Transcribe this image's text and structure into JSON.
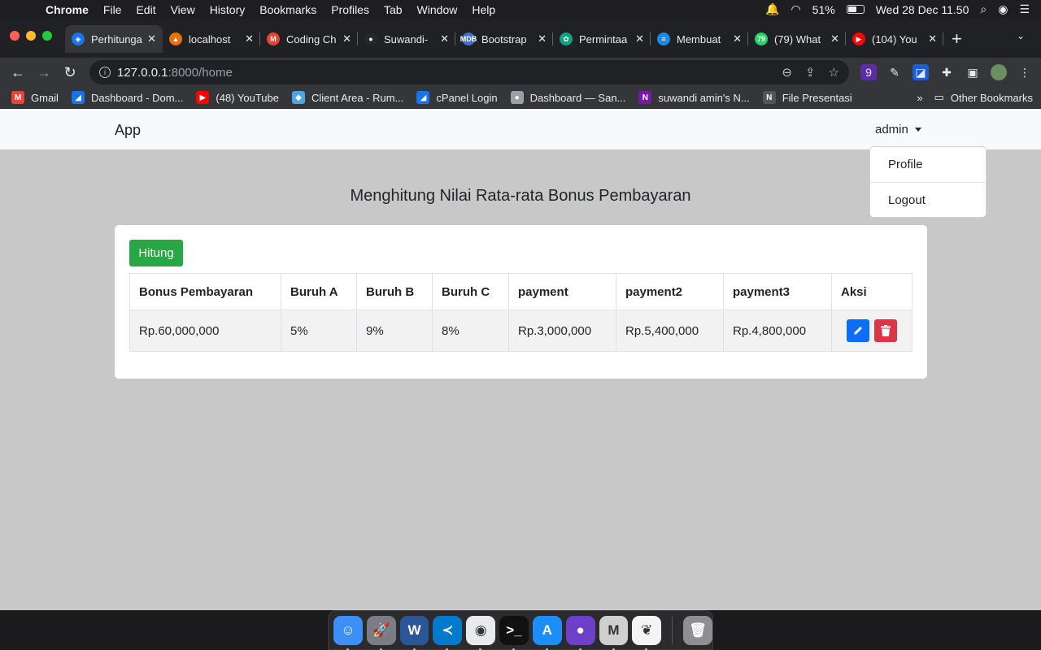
{
  "menubar": {
    "app": "Chrome",
    "items": [
      "File",
      "Edit",
      "View",
      "History",
      "Bookmarks",
      "Profiles",
      "Tab",
      "Window",
      "Help"
    ],
    "battery": "51%",
    "clock": "Wed 28 Dec  11.50"
  },
  "tabs": [
    {
      "title": "Perhitungan",
      "color": "#1a73e8",
      "glyph": "◈"
    },
    {
      "title": "localhost",
      "color": "#e8710a",
      "glyph": "▲"
    },
    {
      "title": "Coding Ch",
      "color": "#ea4335",
      "glyph": "M"
    },
    {
      "title": "Suwandi-",
      "color": "#24292f",
      "glyph": "●"
    },
    {
      "title": "Bootstrap",
      "color": "#3b71ca",
      "glyph": "MDB"
    },
    {
      "title": "Permintaa",
      "color": "#10a37f",
      "glyph": "✿"
    },
    {
      "title": "Membuat",
      "color": "#1e88e5",
      "glyph": "≡"
    },
    {
      "title": "(79) What",
      "color": "#25d366",
      "glyph": "79"
    },
    {
      "title": "(104) You",
      "color": "#ff0000",
      "glyph": "▶"
    }
  ],
  "address": {
    "host": "127.0.0.1",
    "path": ":8000/home"
  },
  "bookmarks": [
    {
      "label": "Gmail",
      "color": "#ea4335",
      "glyph": "M"
    },
    {
      "label": "Dashboard - Dom...",
      "color": "#1a73e8",
      "glyph": "◢"
    },
    {
      "label": "(48) YouTube",
      "color": "#ff0000",
      "glyph": "▶"
    },
    {
      "label": "Client Area - Rum...",
      "color": "#4fa3e0",
      "glyph": "◆"
    },
    {
      "label": "cPanel Login",
      "color": "#1a73e8",
      "glyph": "◢"
    },
    {
      "label": "Dashboard — San...",
      "color": "#9aa0a6",
      "glyph": "●"
    },
    {
      "label": "suwandi amin's N...",
      "color": "#7719aa",
      "glyph": "N"
    },
    {
      "label": "File Presentasi",
      "color": "#555555",
      "glyph": "N"
    }
  ],
  "bookmarks_other": "Other Bookmarks",
  "app": {
    "brand": "App",
    "user": "admin",
    "dropdown": [
      "Profile",
      "Logout"
    ],
    "heading": "Menghitung Nilai Rata-rata Bonus Pembayaran",
    "hitung_label": "Hitung",
    "table": {
      "headers": [
        "Bonus Pembayaran",
        "Buruh A",
        "Buruh B",
        "Buruh C",
        "payment",
        "payment2",
        "payment3",
        "Aksi"
      ],
      "rows": [
        [
          "Rp.60,000,000",
          "5%",
          "9%",
          "8%",
          "Rp.3,000,000",
          "Rp.5,400,000",
          "Rp.4,800,000"
        ]
      ]
    }
  },
  "dock": [
    {
      "name": "finder",
      "color": "#3b8ff6",
      "glyph": "☺"
    },
    {
      "name": "launchpad",
      "color": "#7a7d84",
      "glyph": "🚀"
    },
    {
      "name": "word",
      "color": "#2b579a",
      "glyph": "W"
    },
    {
      "name": "vscode",
      "color": "#007acc",
      "glyph": "≺"
    },
    {
      "name": "chrome",
      "color": "#e8eaed",
      "glyph": "◉"
    },
    {
      "name": "terminal",
      "color": "#111111",
      "glyph": ">_"
    },
    {
      "name": "app-store",
      "color": "#1c8ef9",
      "glyph": "A"
    },
    {
      "name": "github-desktop",
      "color": "#6e40c9",
      "glyph": "●"
    },
    {
      "name": "tableplus",
      "color": "#cfcfcf",
      "glyph": "M"
    },
    {
      "name": "mongodb",
      "color": "#f4f4f4",
      "glyph": "❦"
    }
  ],
  "dock_trash": {
    "name": "trash",
    "color": "#8e8e93",
    "glyph": "🗑"
  }
}
